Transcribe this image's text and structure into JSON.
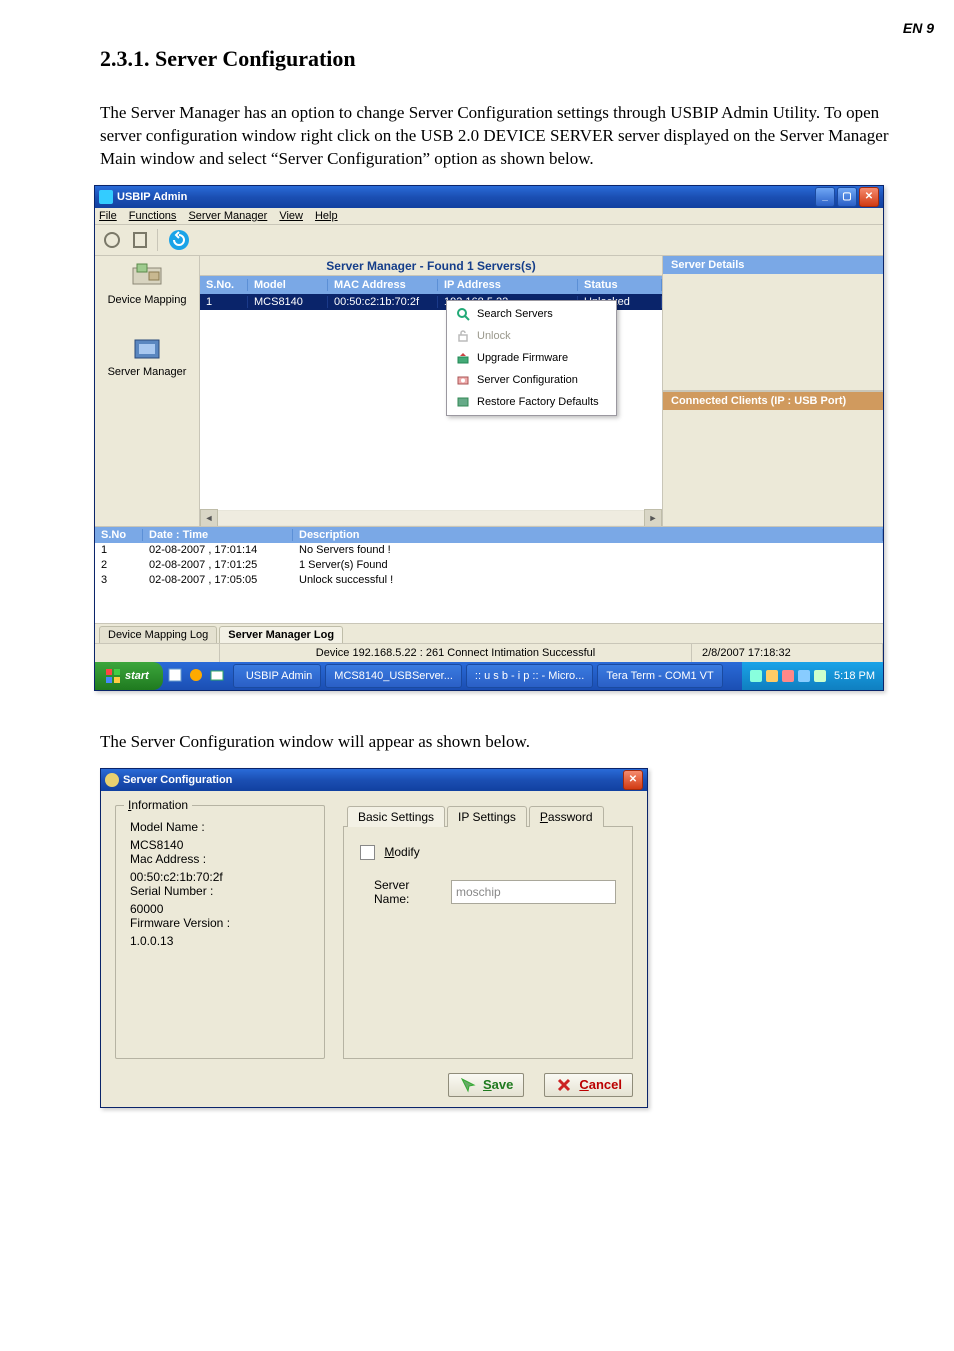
{
  "page_number": "EN 9",
  "section_title": "2.3.1. Server Configuration",
  "paragraph1": "The Server Manager has an option to change Server Configuration settings through USBIP Admin Utility. To open server configuration window right click on the USB 2.0 DEVICE SERVER server displayed on the Server Manager Main window and select “Server Configuration” option as shown below.",
  "paragraph2": "The Server Configuration window will appear as shown below.",
  "win1": {
    "title": "USBIP Admin",
    "menus": {
      "file": "File",
      "functions": "Functions",
      "server_manager": "Server Manager",
      "view": "View",
      "help": "Help"
    },
    "nav": {
      "device_mapping": "Device Mapping",
      "server_manager": "Server Manager"
    },
    "server_manager_header": "Server Manager - Found 1 Servers(s)",
    "grid": {
      "cols": {
        "sno": "S.No.",
        "model": "Model",
        "mac": "MAC Address",
        "ip": "IP Address",
        "status": "Status"
      },
      "rows": [
        {
          "sno": "1",
          "model": "MCS8140",
          "mac": "00:50:c2:1b:70:2f",
          "ip": "192.168.5.22",
          "status": "Unlocked"
        }
      ]
    },
    "context_menu": {
      "search": "Search Servers",
      "unlock": "Unlock",
      "upgrade": "Upgrade Firmware",
      "server_config": "Server Configuration",
      "restore": "Restore Factory Defaults"
    },
    "details_header": "Server Details",
    "connected_header": "Connected Clients (IP : USB Port)",
    "log": {
      "cols": {
        "sno": "S.No",
        "datetime": "Date : Time",
        "desc": "Description"
      },
      "rows": [
        {
          "sno": "1",
          "dt": "02-08-2007 , 17:01:14",
          "desc": "No Servers found !"
        },
        {
          "sno": "2",
          "dt": "02-08-2007 , 17:01:25",
          "desc": "1 Server(s) Found"
        },
        {
          "sno": "3",
          "dt": "02-08-2007 , 17:05:05",
          "desc": "Unlock successful !"
        }
      ]
    },
    "bottom_tabs": {
      "dml": "Device Mapping Log",
      "sml": "Server Manager Log"
    },
    "status": {
      "center": "Device 192.168.5.22 : 261 Connect Intimation Successful",
      "right": "2/8/2007 17:18:32"
    },
    "taskbar": {
      "start": "start",
      "items": [
        "USBIP Admin",
        "MCS8140_USBServer...",
        ":: u s b - i p :: - Micro...",
        "Tera Term - COM1 VT"
      ],
      "clock": "5:18 PM"
    }
  },
  "win2": {
    "title": "Server Configuration",
    "info": {
      "legend": "Information",
      "model_label": "Model Name :",
      "model_value": "MCS8140",
      "mac_label": "Mac Address :",
      "mac_value": "00:50:c2:1b:70:2f",
      "serial_label": "Serial Number :",
      "serial_value": "60000",
      "fw_label": "Firmware Version :",
      "fw_value": "1.0.0.13"
    },
    "tabs": {
      "basic": "Basic Settings",
      "ip": "IP Settings",
      "password": "Password"
    },
    "basic": {
      "modify": "Modify",
      "server_name_label": "Server Name:",
      "server_name_value": "moschip"
    },
    "buttons": {
      "save": "Save",
      "cancel": "Cancel"
    }
  }
}
